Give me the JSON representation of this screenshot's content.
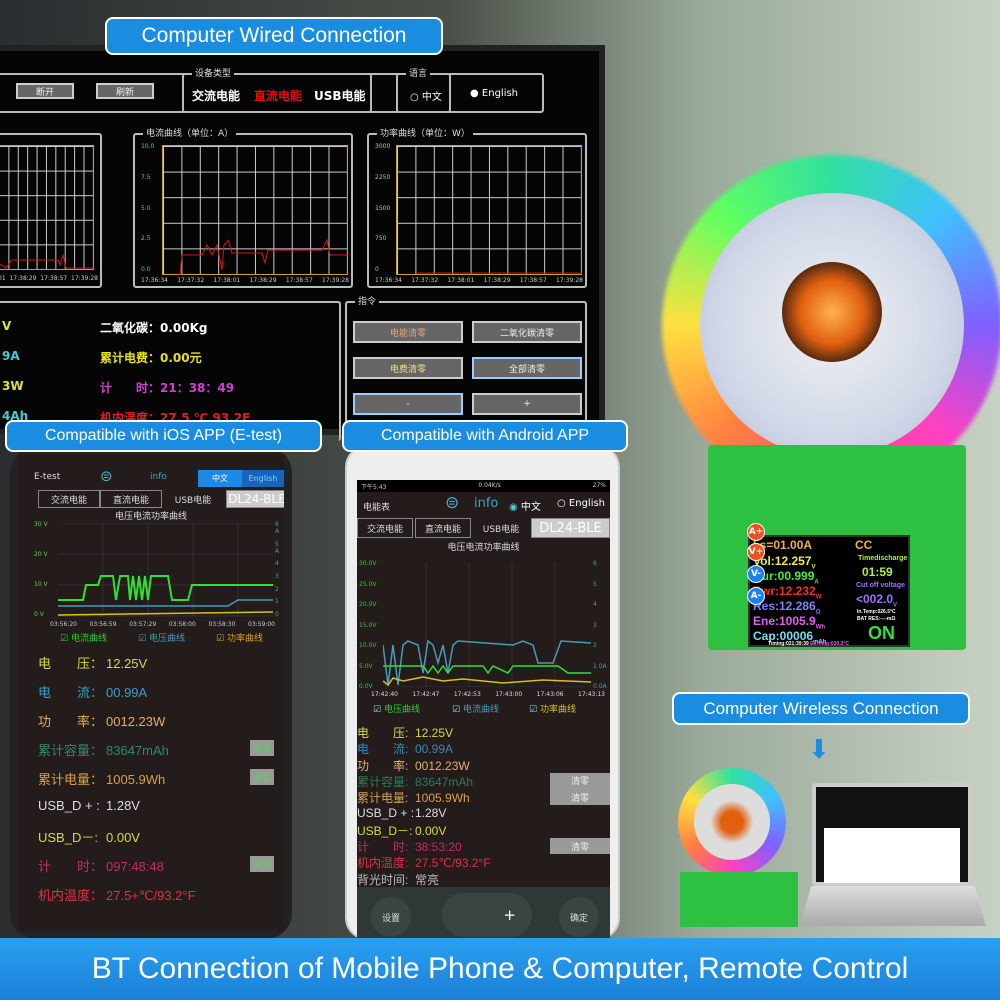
{
  "banners": {
    "wired": "Computer Wired Connection",
    "ios": "Compatible with iOS APP (E-test)",
    "android": "Compatible with Android APP",
    "wireless": "Computer Wireless Connection",
    "bottom": "BT Connection of Mobile Phone & Computer, Remote Control"
  },
  "pc": {
    "buttons": [
      "断开",
      "刷新"
    ],
    "device_type": {
      "caption": "设备类型",
      "options": [
        "交流电能",
        "直流电能",
        "USB电能"
      ]
    },
    "language": {
      "caption": "语言",
      "options": [
        "中文",
        "English"
      ]
    },
    "current_chart": {
      "caption": "电流曲线（单位：A）",
      "yticks": [
        "10.0",
        "7.5",
        "5.0",
        "2.5",
        "0.0"
      ],
      "xticks": [
        "17:36:34",
        "17:37:32",
        "17:38:01",
        "17:38:29",
        "17:38:57",
        "17:39:28"
      ]
    },
    "power_chart": {
      "caption": "功率曲线（单位：W）",
      "yticks": [
        "3000",
        "2250",
        "1500",
        "750",
        "0"
      ],
      "xticks": [
        "17:36:34",
        "17:37:32",
        "17:38:01",
        "17:38:29",
        "17:38:57",
        "17:39:28"
      ]
    },
    "left_chart": {
      "xticks": [
        "01",
        "17:38:29",
        "17:38:57",
        "17:39:28"
      ]
    },
    "readings_left": [
      "V",
      "9A",
      "3W",
      "4Ah"
    ],
    "readings_right": [
      "二氧化碳：0.00Kg",
      "累计电费：0.00元",
      "计　　时：21：38：49",
      "机内温度：27.5 ℃  93.2F"
    ],
    "commands": {
      "caption": "指令",
      "buttons": [
        "电能清零",
        "二氧化碳清零",
        "电费清零",
        "全部清零",
        "-",
        "+"
      ]
    }
  },
  "ios": {
    "app": "E-test",
    "info": "info",
    "lang": [
      "中文",
      "English"
    ],
    "tabs": [
      "交流电能",
      "直流电能",
      "USB电能",
      "DL24-BLE"
    ],
    "chart_title": "电压电流功率曲线",
    "yleft": [
      "30 V",
      "20 V",
      "10 V",
      "0 V"
    ],
    "yright": [
      "6 A",
      "5 A",
      "4",
      "3",
      "2",
      "1",
      "0"
    ],
    "xticks": [
      "03:56:20",
      "03:56:59",
      "03:57:29",
      "03:58:00",
      "03:58:30",
      "03:59:00"
    ],
    "legend": [
      "电流曲线",
      "电压曲线",
      "功率曲线"
    ],
    "rows": [
      {
        "label": "电　　压：",
        "value": "12.25V",
        "color": "#d8d84a"
      },
      {
        "label": "电　　流：",
        "value": "00.99A",
        "color": "#3aa0c8"
      },
      {
        "label": "功　　率：",
        "value": "0012.23W",
        "color": "#e0b060"
      },
      {
        "label": "累计容量：",
        "value": "83647mAh",
        "color": "#2f8a6a",
        "clear": "清零"
      },
      {
        "label": "累计电量：",
        "value": "1005.9Wh",
        "color": "#d8a040",
        "clear": "清零"
      },
      {
        "label": "USB_D + :",
        "value": "1.28V",
        "color": "#dddddd"
      },
      {
        "label": "USB_D－:",
        "value": "0.00V",
        "color": "#d8d84a"
      },
      {
        "label": "计　　时：",
        "value": "097:48:48",
        "color": "#c03060",
        "clear": "清零"
      },
      {
        "label": "机内温度：",
        "value": "27.5+℃/93.2°F",
        "color": "#e0304a"
      }
    ]
  },
  "android": {
    "status": {
      "time": "下午5:43",
      "speed": "0.04K/s",
      "battery": "27%"
    },
    "app": "电能表",
    "info": "info",
    "lang": [
      "中文",
      "English"
    ],
    "tabs": [
      "交流电能",
      "直流电能",
      "USB电能",
      "DL24-BLE"
    ],
    "chart_title": "电压电流功率曲线",
    "yleft": [
      "30.0V",
      "25.0V",
      "20.0V",
      "15.0V",
      "10.0V",
      "5.0V",
      "0.0V"
    ],
    "yright": [
      "6",
      "5",
      "4",
      "3",
      "2",
      "1.0A",
      "0.0A"
    ],
    "xticks": [
      "17:42:40",
      "17:42:47",
      "17:42:53",
      "17:43:00",
      "17:43:06",
      "17:43:13"
    ],
    "legend": [
      "电压曲线",
      "电流曲线",
      "功率曲线"
    ],
    "rows": [
      {
        "label": "电　　压:",
        "value": "12.25V",
        "color": "#d8d84a"
      },
      {
        "label": "电　　流:",
        "value": "00.99A",
        "color": "#3a8ab8"
      },
      {
        "label": "功　　率:",
        "value": "0012.23W",
        "color": "#e0b070"
      },
      {
        "label": "累计容量:",
        "value": "83647mAh",
        "color": "#2f7a5a",
        "clear": "清零"
      },
      {
        "label": "累计电量:",
        "value": "1005.9Wh",
        "color": "#d8a050",
        "clear": "清零"
      },
      {
        "label": "USB_D + :",
        "value": "1.28V",
        "color": "#dddddd"
      },
      {
        "label": "USB_D－:",
        "value": "0.00V",
        "color": "#d8d84a"
      },
      {
        "label": "计　　时:",
        "value": "38:53:20",
        "color": "#c03060",
        "clear": "清零"
      },
      {
        "label": "机内温度:",
        "value": "27.5℃/93.2°F",
        "color": "#e0304a"
      },
      {
        "label": "背光时间:",
        "value": "常亮",
        "color": "#bbbbbb"
      }
    ],
    "bottom": [
      "设置",
      "+",
      "确定"
    ]
  },
  "lcd": {
    "setpoint": "I s=01.00A",
    "mode": "CC",
    "vol": "Vol:12.257",
    "vol_unit": "V",
    "cur": "Cur:00.999",
    "cur_unit": "A",
    "pwr": "Pwr:12.232",
    "pwr_unit": "W",
    "res": "Res:12.286",
    "res_unit": "Ω",
    "ene": "Ene:1005.9",
    "ene_unit": "Wh",
    "cap": "Cap:00006",
    "cap_unit": "mAh",
    "timed_label": "Timedischarge",
    "timed": "01:59",
    "cutoff_label": "Cut off voltage",
    "cutoff": "<002.0",
    "cutoff_unit": "V",
    "in_temp": "In.Temp:026.5°C",
    "bat_res": "BAT RES:----mΩ",
    "state": "ON",
    "timing": "Timing:021:39:39",
    "ex_temp": "ExTemp:030.2°C",
    "pins": [
      "A+",
      "V+",
      "V-",
      "A-"
    ]
  },
  "colors": {
    "banner": "#1a8de0"
  }
}
